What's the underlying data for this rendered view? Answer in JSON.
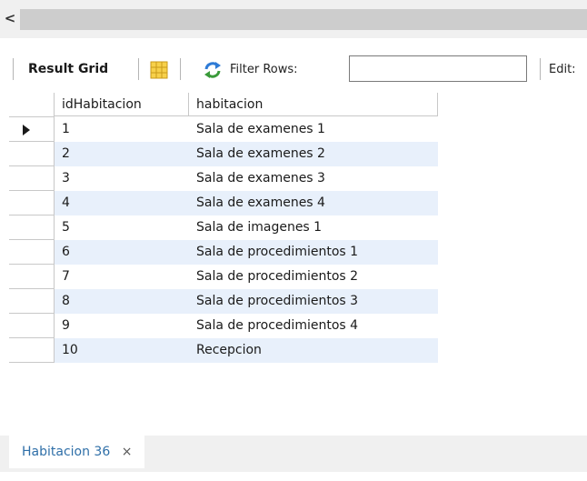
{
  "nav": {
    "scroll_left_glyph": "<"
  },
  "toolbar": {
    "result_grid_label": "Result Grid",
    "filter_label": "Filter Rows:",
    "filter_value": "",
    "edit_label": "Edit:"
  },
  "grid": {
    "columns": [
      "idHabitacion",
      "habitacion"
    ],
    "rows": [
      {
        "id": "1",
        "name": "Sala de examenes 1"
      },
      {
        "id": "2",
        "name": "Sala de examenes 2"
      },
      {
        "id": "3",
        "name": "Sala de examenes 3"
      },
      {
        "id": "4",
        "name": "Sala de examenes 4"
      },
      {
        "id": "5",
        "name": "Sala de imagenes 1"
      },
      {
        "id": "6",
        "name": "Sala de procedimientos 1"
      },
      {
        "id": "7",
        "name": "Sala de procedimientos 2"
      },
      {
        "id": "8",
        "name": "Sala de procedimientos 3"
      },
      {
        "id": "9",
        "name": "Sala de procedimientos 4"
      },
      {
        "id": "10",
        "name": "Recepcion"
      }
    ],
    "selected_row": 0
  },
  "tabs": [
    {
      "label": "Habitacion 36",
      "close_glyph": "×"
    }
  ],
  "colors": {
    "alt_row": "#e8f0fb",
    "tab_text": "#2f6fa8"
  }
}
